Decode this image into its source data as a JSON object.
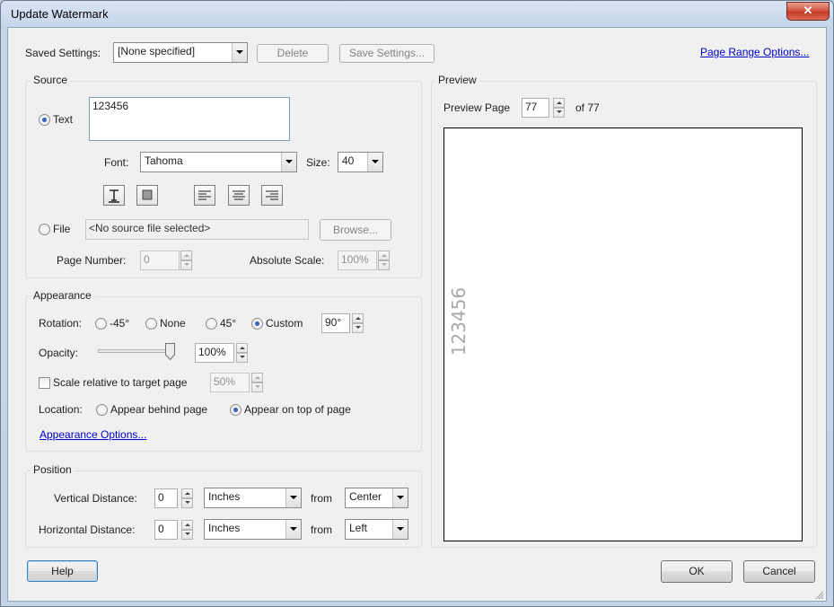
{
  "window": {
    "title": "Update Watermark",
    "close_glyph": "✕"
  },
  "top": {
    "saved_settings_label": "Saved Settings:",
    "saved_settings_value": "[None specified]",
    "delete_label": "Delete",
    "save_settings_label": "Save Settings...",
    "page_range_options_label": "Page Range Options..."
  },
  "source": {
    "group_label": "Source",
    "text_radio_label": "Text",
    "text_value": "123456",
    "font_label": "Font:",
    "font_value": "Tahoma",
    "size_label": "Size:",
    "size_value": "40",
    "file_radio_label": "File",
    "file_value": "<No source file selected>",
    "browse_label": "Browse...",
    "page_number_label": "Page Number:",
    "page_number_value": "0",
    "absolute_scale_label": "Absolute Scale:",
    "absolute_scale_value": "100%"
  },
  "appearance": {
    "group_label": "Appearance",
    "rotation_label": "Rotation:",
    "rot_neg45_label": "-45°",
    "rot_none_label": "None",
    "rot_45_label": "45°",
    "rot_custom_label": "Custom",
    "rot_custom_value": "90°",
    "opacity_label": "Opacity:",
    "opacity_value": "100%",
    "opacity_fraction": 1.0,
    "scale_relative_label": "Scale relative to target page",
    "scale_relative_value": "50%",
    "location_label": "Location:",
    "appear_behind_label": "Appear behind page",
    "appear_on_top_label": "Appear on top of page",
    "appearance_options_label": "Appearance Options..."
  },
  "position": {
    "group_label": "Position",
    "vertical_label": "Vertical Distance:",
    "vertical_value": "0",
    "vertical_unit": "Inches",
    "vertical_from_label": "from",
    "vertical_from_value": "Center",
    "horizontal_label": "Horizontal Distance:",
    "horizontal_value": "0",
    "horizontal_unit": "Inches",
    "horizontal_from_label": "from",
    "horizontal_from_value": "Left"
  },
  "preview": {
    "group_label": "Preview",
    "preview_page_label": "Preview Page",
    "preview_page_value": "77",
    "of_label": "of 77",
    "watermark_text": "123456"
  },
  "footer": {
    "help_label": "Help",
    "ok_label": "OK",
    "cancel_label": "Cancel"
  },
  "colors": {
    "titlebar": "#c6d6ea",
    "dialog_bg": "#f0f0f0",
    "link": "#0000cc",
    "close_button": "#c13a25",
    "watermark_text": "#a8a8a8"
  }
}
